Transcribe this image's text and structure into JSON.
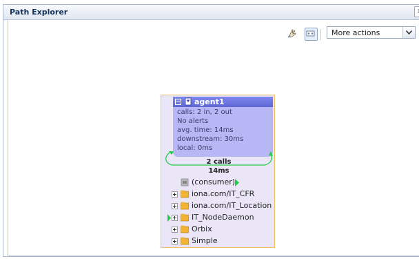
{
  "window": {
    "title": "Path Explorer",
    "close_label": "×"
  },
  "toolbar": {
    "more_actions_label": "More actions"
  },
  "agent": {
    "name": "agent1",
    "calls": "calls: 2 in, 2 out",
    "alerts": "No alerts",
    "avg_time": "avg. time: 14ms",
    "downstream": "downstream: 30ms",
    "local": "local: 0ms",
    "loop_calls": "2 calls",
    "loop_time": "14ms"
  },
  "tree": {
    "consumer": "(consumer)",
    "items": [
      "iona.com/IT_CFR",
      "iona.com/IT_Location",
      "IT_NodeDaemon",
      "Orbix",
      "Simple"
    ]
  },
  "colors": {
    "agent_header": "#6b72e0",
    "agent_body": "#b7b7f5",
    "node_bg": "#eae6f8",
    "call_arrow": "#22cc44",
    "folder": "#f2b233"
  }
}
